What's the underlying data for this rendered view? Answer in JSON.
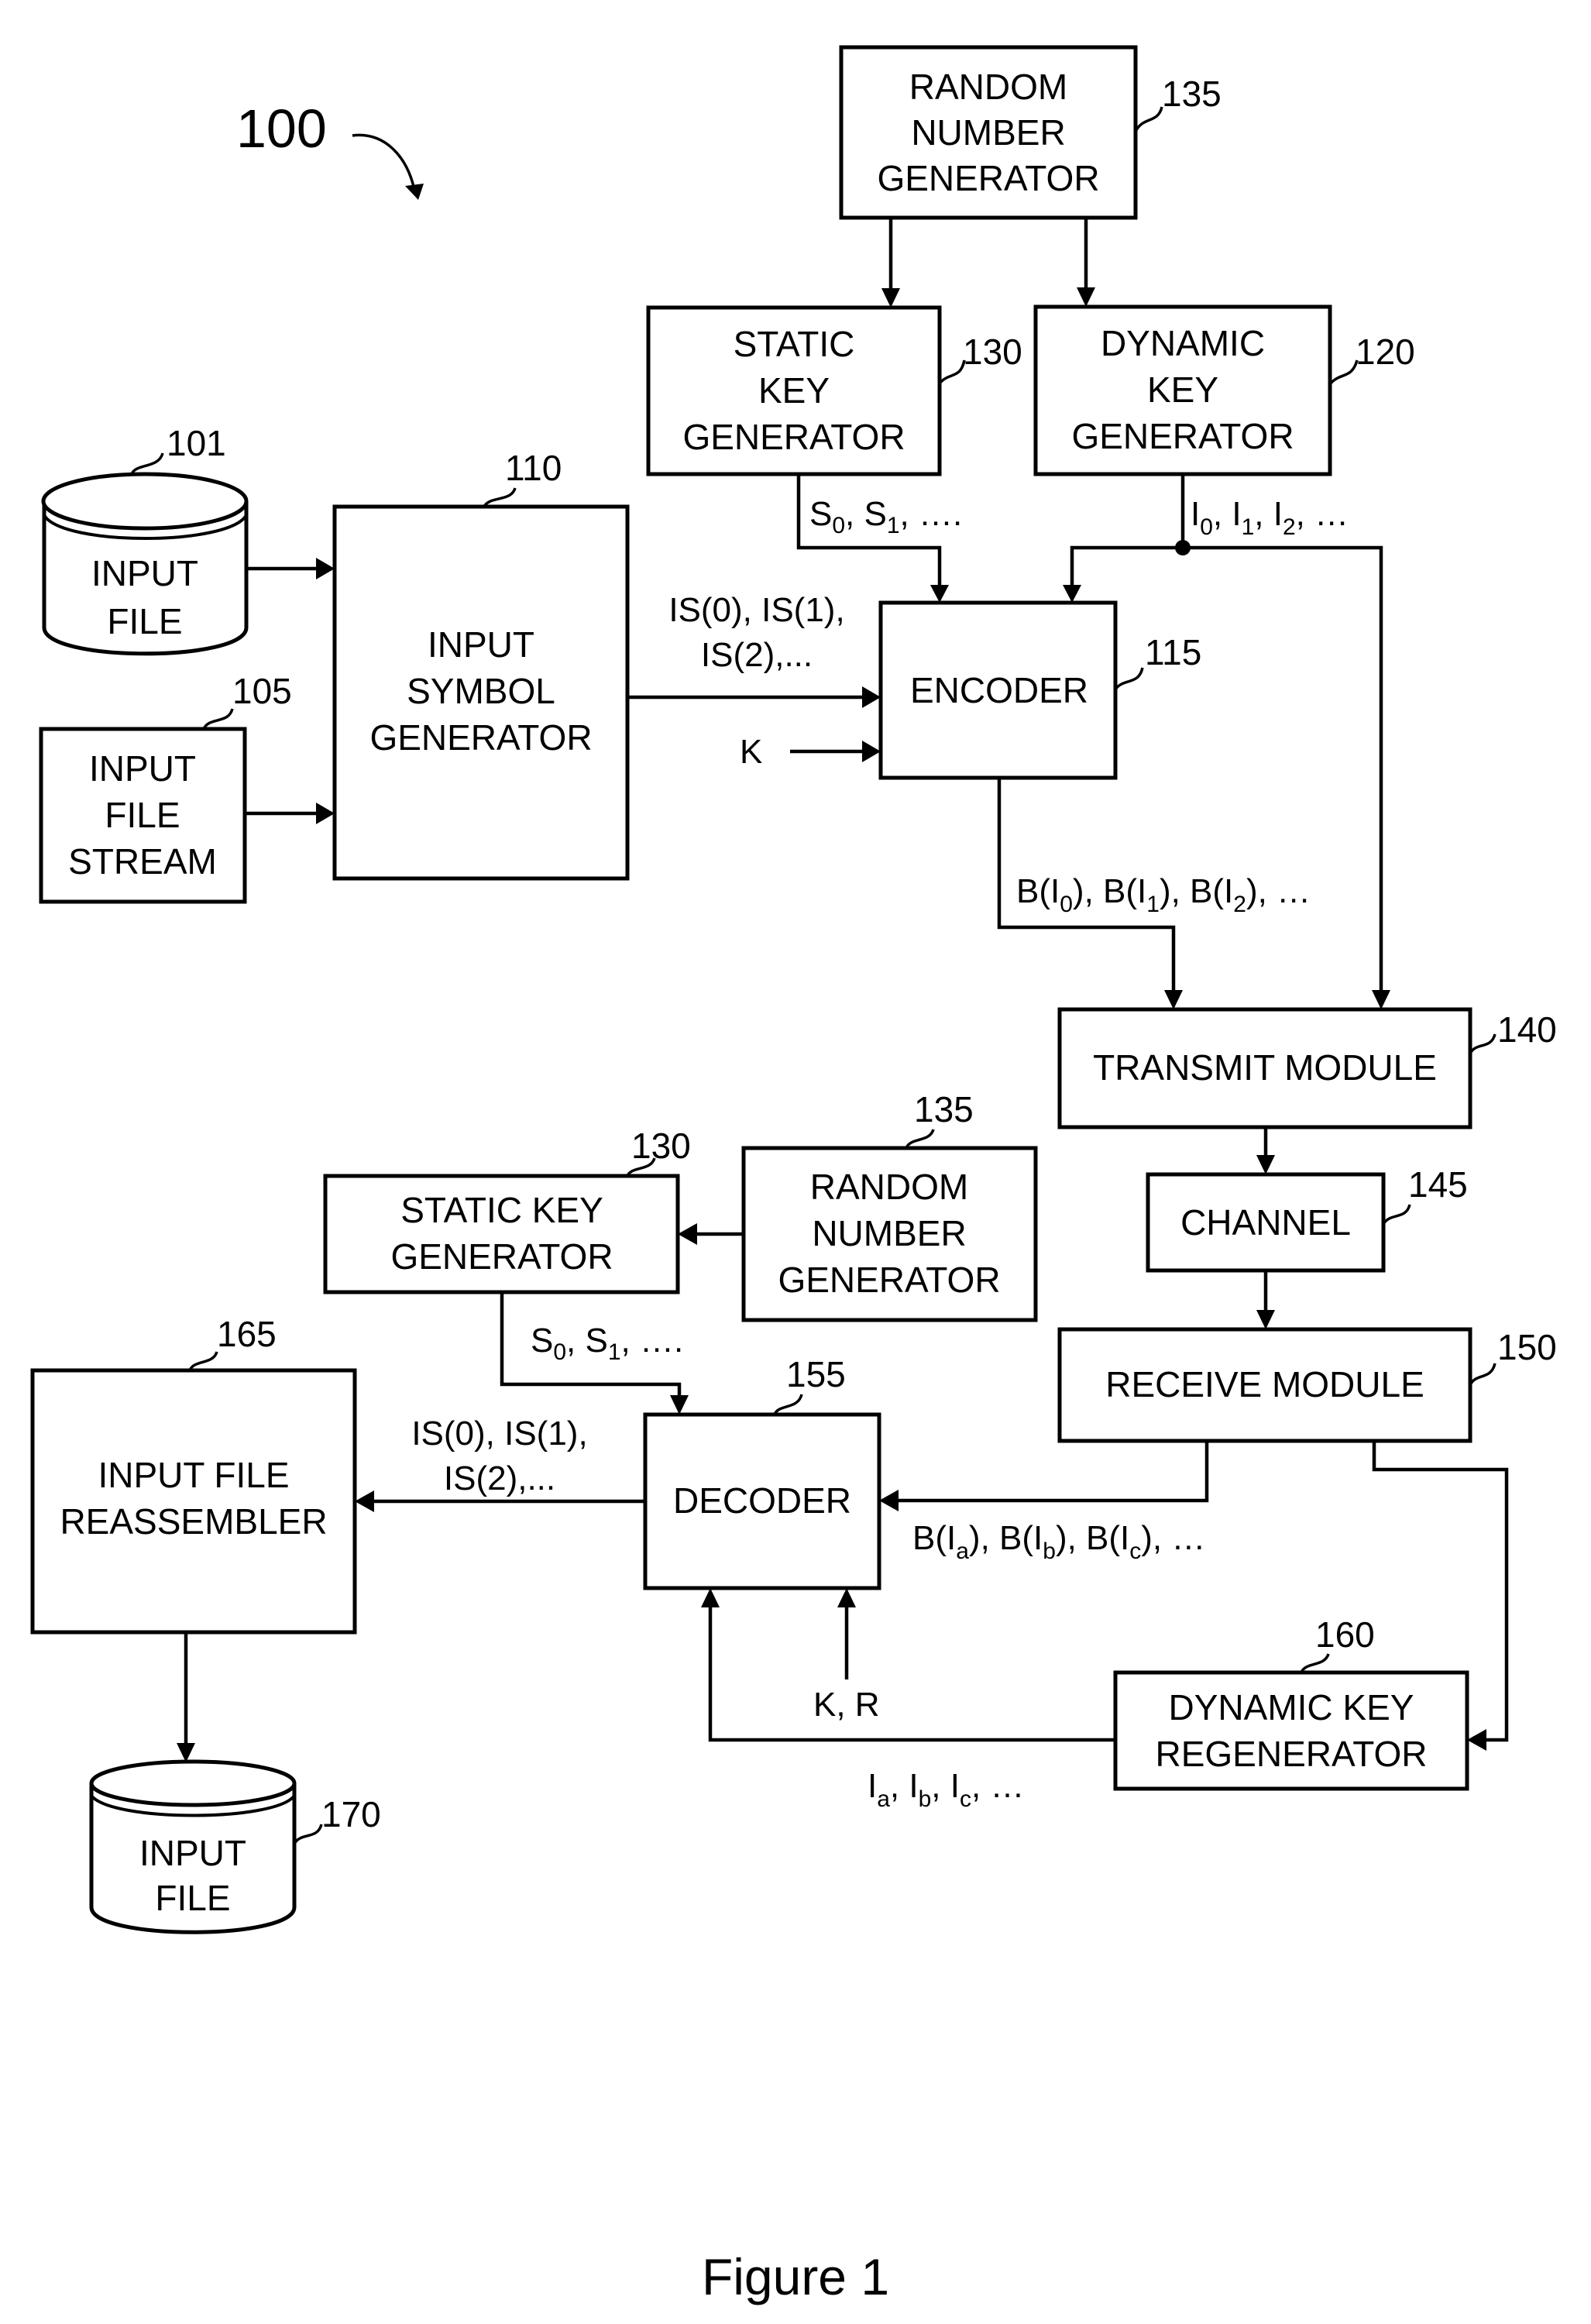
{
  "figure": {
    "system_ref": "100",
    "caption": "Figure 1"
  },
  "blocks": {
    "rng_top": {
      "lines": [
        "RANDOM",
        "NUMBER",
        "GENERATOR"
      ],
      "ref": "135"
    },
    "static_key_gen_top": {
      "lines": [
        "STATIC",
        "KEY",
        "GENERATOR"
      ],
      "ref": "130"
    },
    "dynamic_key_gen": {
      "lines": [
        "DYNAMIC",
        "KEY",
        "GENERATOR"
      ],
      "ref": "120"
    },
    "input_file_source": {
      "lines": [
        "INPUT",
        "FILE"
      ],
      "ref": "101"
    },
    "input_file_stream": {
      "lines": [
        "INPUT",
        "FILE",
        "STREAM"
      ],
      "ref": "105"
    },
    "input_symbol_gen": {
      "lines": [
        "INPUT",
        "SYMBOL",
        "GENERATOR"
      ],
      "ref": "110"
    },
    "encoder": {
      "lines": [
        "ENCODER"
      ],
      "ref": "115"
    },
    "transmit_module": {
      "lines": [
        "TRANSMIT MODULE"
      ],
      "ref": "140"
    },
    "channel": {
      "lines": [
        "CHANNEL"
      ],
      "ref": "145"
    },
    "receive_module": {
      "lines": [
        "RECEIVE MODULE"
      ],
      "ref": "150"
    },
    "static_key_gen_bottom": {
      "lines": [
        "STATIC KEY",
        "GENERATOR"
      ],
      "ref": "130"
    },
    "rng_bottom": {
      "lines": [
        "RANDOM",
        "NUMBER",
        "GENERATOR"
      ],
      "ref": "135"
    },
    "reassembler": {
      "lines": [
        "INPUT FILE",
        "REASSEMBLER"
      ],
      "ref": "165"
    },
    "decoder": {
      "lines": [
        "DECODER"
      ],
      "ref": "155"
    },
    "dynamic_key_regen": {
      "lines": [
        "DYNAMIC KEY",
        "REGENERATOR"
      ],
      "ref": "160"
    },
    "input_file_output": {
      "lines": [
        "INPUT",
        "FILE"
      ],
      "ref": "170"
    }
  },
  "signals": {
    "static_keys": [
      {
        "base": "S",
        "sub": "0"
      },
      {
        "base": "S",
        "sub": "1"
      },
      {
        "tail": "…."
      }
    ],
    "dynamic_keys": [
      {
        "base": "I",
        "sub": "0"
      },
      {
        "base": "I",
        "sub": "1"
      },
      {
        "base": "I",
        "sub": "2"
      },
      {
        "tail": "…"
      }
    ],
    "input_symbols_line1": "IS(0), IS(1),",
    "input_symbols_line2": "IS(2),...",
    "k": "K",
    "encoded_symbols": [
      {
        "sub": "0"
      },
      {
        "sub": "1"
      },
      {
        "sub": "2"
      }
    ],
    "received_symbols": [
      {
        "sub": "a"
      },
      {
        "sub": "b"
      },
      {
        "sub": "c"
      }
    ],
    "k_r": "K, R",
    "regenerated_keys": [
      {
        "sub": "a"
      },
      {
        "sub": "b"
      },
      {
        "sub": "c"
      }
    ],
    "ellipsis": "…"
  }
}
